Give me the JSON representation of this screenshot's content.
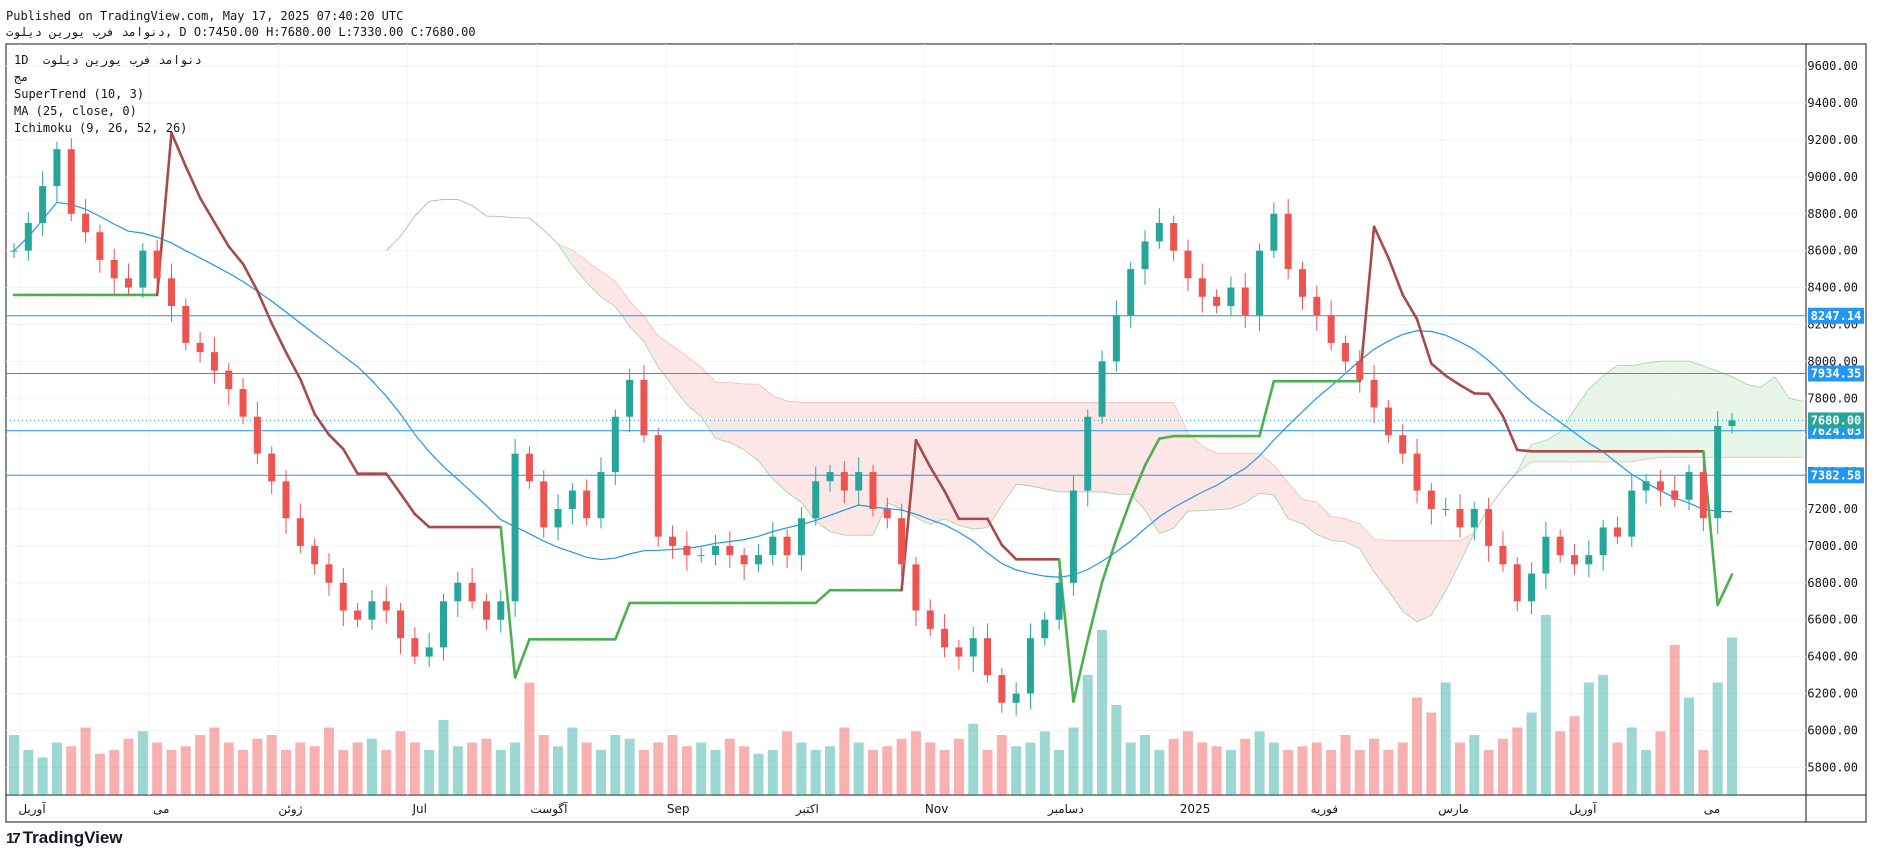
{
  "header": {
    "line1": "Published on TradingView.com, May 17, 2025 07:40:20 UTC",
    "line2": "دنوامد فرب يورين ديلوت, D O:7450.00 H:7680.00 L:7330.00 C:7680.00"
  },
  "legend": {
    "symbol": "دنوامد فرب  يورين ديلوت",
    "interval": "1D",
    "sub": "مج",
    "supertrend": "SuperTrend (10, 3)",
    "ma": "MA (25, close, 0)",
    "ichimoku": "Ichimoku (9, 26, 52, 26)"
  },
  "footer": {
    "brand": "TradingView",
    "logo_mark": "17"
  },
  "colors": {
    "up": "#26a69a",
    "down": "#ef5350",
    "supertrend_up": "#4caf50",
    "supertrend_down": "#a84a4a",
    "ma": "#2196f3",
    "hline": "#2196f3",
    "cloud_bull": "#e8f5e9",
    "cloud_bear": "#fde6e6"
  },
  "chart_data": {
    "type": "line",
    "x_ticks": [
      "آوریل",
      "می",
      "ژوئن",
      "Jul",
      "آگوست",
      "Sep",
      "اکتبر",
      "Nov",
      "دسامبر",
      "2025",
      "فوریه",
      "مارس",
      "آوریل",
      "می"
    ],
    "y_ticks": [
      5800,
      6000,
      6200,
      6400,
      6600,
      6800,
      7000,
      7200,
      7400,
      7600,
      7800,
      8000,
      8200,
      8400,
      8600,
      8800,
      9000,
      9200,
      9400,
      9600
    ],
    "ylim": [
      5650,
      9720
    ],
    "horizontal_levels": [
      8247.14,
      7934.35,
      7624.03,
      7382.58
    ],
    "last_price": 7680.0,
    "close_series": [
      8600,
      8750,
      8950,
      9150,
      8800,
      8700,
      8550,
      8450,
      8400,
      8600,
      8450,
      8300,
      8100,
      8050,
      7950,
      7850,
      7700,
      7500,
      7350,
      7150,
      7000,
      6900,
      6800,
      6650,
      6600,
      6700,
      6650,
      6500,
      6400,
      6450,
      6700,
      6800,
      6700,
      6600,
      6700,
      7500,
      7350,
      7100,
      7200,
      7300,
      7150,
      7400,
      7700,
      7900,
      7600,
      7050,
      7000,
      6950,
      6950,
      7000,
      6950,
      6900,
      6950,
      7050,
      6950,
      7150,
      7350,
      7400,
      7300,
      7400,
      7200,
      7150,
      6900,
      6650,
      6550,
      6450,
      6400,
      6500,
      6300,
      6150,
      6200,
      6500,
      6600,
      6800,
      7300,
      7700,
      8000,
      8250,
      8500,
      8650,
      8750,
      8600,
      8450,
      8350,
      8300,
      8400,
      8250,
      8600,
      8800,
      8500,
      8350,
      8250,
      8100,
      8000,
      7900,
      7750,
      7600,
      7500,
      7300,
      7200,
      7200,
      7100,
      7200,
      7000,
      6900,
      6700,
      6850,
      7050,
      6950,
      6900,
      6950,
      7100,
      7050,
      7300,
      7350,
      7300,
      7250,
      7400,
      7150,
      7650,
      7680
    ],
    "volume_series": [
      80,
      60,
      50,
      70,
      65,
      90,
      55,
      60,
      75,
      85,
      70,
      60,
      65,
      80,
      90,
      70,
      60,
      75,
      80,
      60,
      70,
      65,
      90,
      60,
      70,
      75,
      60,
      85,
      70,
      60,
      100,
      65,
      70,
      75,
      60,
      70,
      150,
      80,
      65,
      90,
      70,
      60,
      80,
      75,
      60,
      70,
      80,
      65,
      70,
      60,
      75,
      65,
      55,
      60,
      85,
      70,
      60,
      65,
      90,
      70,
      60,
      65,
      75,
      85,
      70,
      60,
      75,
      95,
      60,
      80,
      65,
      70,
      85,
      60,
      90,
      160,
      220,
      120,
      70,
      80,
      60,
      75,
      85,
      70,
      65,
      60,
      75,
      85,
      70,
      60,
      65,
      70,
      60,
      80,
      60,
      75,
      60,
      70,
      130,
      110,
      150,
      70,
      80,
      60,
      75,
      90,
      110,
      240,
      85,
      105,
      150,
      160,
      70,
      90,
      60,
      85,
      200,
      130,
      60,
      150,
      210
    ],
    "supertrend": {
      "label": "SuperTrend (10, 3)"
    },
    "ma": {
      "label": "MA (25, close, 0)"
    },
    "ichimoku": {
      "label": "Ichimoku (9, 26, 52, 26)"
    }
  }
}
